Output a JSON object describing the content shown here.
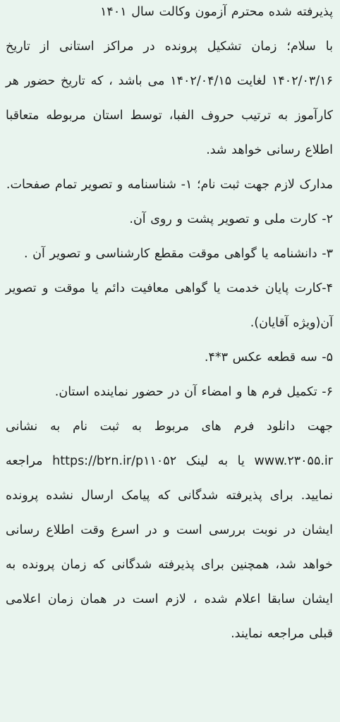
{
  "message": {
    "heading": "پذیرفته شده محترم آزمون وکالت سال ۱۴۰۱",
    "intro": "با سلام؛ زمان تشکیل پرونده در مراکز استانی از تاریخ ۱۴۰۲/۰۳/۱۶ لغایت ۱۴۰۲/۰۴/۱۵ می باشد ، که تاریخ حضور هر کارآموز به ترتیب حروف الفبا، توسط استان مربوطه متعاقبا اطلاع رسانی خواهد شد.",
    "documents_intro": "مدارک لازم جهت ثبت نام؛ ۱- شناسنامه و تصویر تمام صفحات.",
    "item_2": "۲- کارت ملی و تصویر پشت و روی آن.",
    "item_3": "۳- دانشنامه یا گواهی موقت مقطع کارشناسی و تصویر آن .",
    "item_4": "۴-کارت پایان خدمت یا گواهی معافیت دائم یا موقت و تصویر آن(ویژه آقایان).",
    "item_5": "۵- سه قطعه عکس ۳*۴.",
    "item_6": "۶- تکمیل فرم ها و امضاء آن در حضور نماینده استان.",
    "download_prefix": "جهت دانلود فرم های مربوط به ثبت نام به نشانی",
    "site_url": "www.۲۳۰۵۵.ir",
    "link_word": "یا به لینک",
    "short_link": "https://b۲n.ir/p۱۱۰۵۲",
    "closing": "مراجعه نمایید. برای پذیرفته شدگانی که پیامک ارسال نشده پرونده ایشان در نوبت بررسی است و در اسرع وقت اطلاع رسانی خواهد شد، همچنین برای پذیرفته شدگانی که زمان پرونده به ایشان سابقا اعلام شده ، لازم است در همان زمان اعلامی قبلی مراجعه نمایند."
  }
}
